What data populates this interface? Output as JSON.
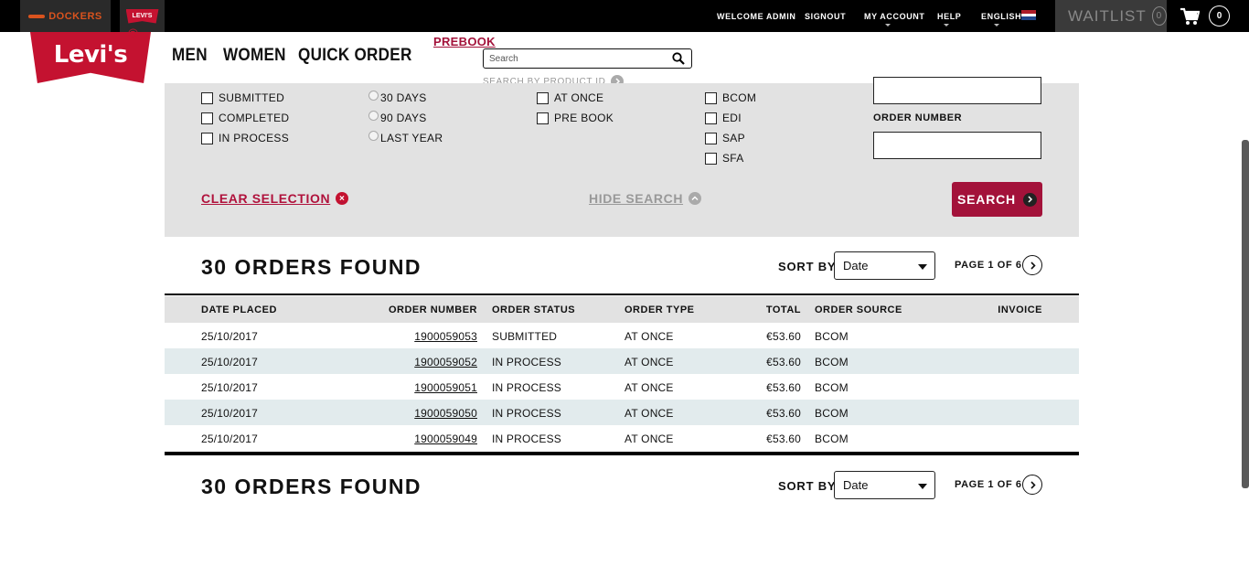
{
  "topbar": {
    "brand_dockers": "DOCKERS",
    "brand_levis": "LEVI'S",
    "welcome": "WELCOME ADMIN",
    "signout": "SIGNOUT",
    "my_account": "MY ACCOUNT",
    "help": "HELP",
    "language": "ENGLISH",
    "waitlist_label": "WAITLIST",
    "waitlist_count": "0",
    "cart_count": "0"
  },
  "header": {
    "logo_text": "Levi's",
    "logo_mark": "®",
    "nav": [
      "MEN",
      "WOMEN",
      "QUICK ORDER"
    ],
    "prebook": "PREBOOK",
    "search_placeholder": "Search",
    "search_by_product": "SEARCH BY PRODUCT ID"
  },
  "filters": {
    "status": [
      "SUBMITTED",
      "COMPLETED",
      "IN PROCESS"
    ],
    "period": [
      "30 DAYS",
      "90 DAYS",
      "LAST YEAR"
    ],
    "order_type": [
      "AT ONCE",
      "PRE BOOK"
    ],
    "source": [
      "BCOM",
      "EDI",
      "SAP",
      "SFA"
    ],
    "order_number_label": "ORDER NUMBER",
    "clear_selection": "CLEAR SELECTION",
    "hide_search": "HIDE SEARCH",
    "search_button": "SEARCH"
  },
  "results": {
    "found_label": "30 ORDERS FOUND",
    "sort_by_label": "SORT BY:",
    "sort_value": "Date",
    "page_info": "PAGE 1 OF 6"
  },
  "table": {
    "headers": [
      "DATE PLACED",
      "ORDER NUMBER",
      "ORDER STATUS",
      "ORDER TYPE",
      "TOTAL",
      "ORDER SOURCE",
      "INVOICE"
    ],
    "rows": [
      {
        "date": "25/10/2017",
        "number": "1900059053",
        "status": "SUBMITTED",
        "type": "AT ONCE",
        "total": "€53.60",
        "source": "BCOM"
      },
      {
        "date": "25/10/2017",
        "number": "1900059052",
        "status": "IN PROCESS",
        "type": "AT ONCE",
        "total": "€53.60",
        "source": "BCOM"
      },
      {
        "date": "25/10/2017",
        "number": "1900059051",
        "status": "IN PROCESS",
        "type": "AT ONCE",
        "total": "€53.60",
        "source": "BCOM"
      },
      {
        "date": "25/10/2017",
        "number": "1900059050",
        "status": "IN PROCESS",
        "type": "AT ONCE",
        "total": "€53.60",
        "source": "BCOM"
      },
      {
        "date": "25/10/2017",
        "number": "1900059049",
        "status": "IN PROCESS",
        "type": "AT ONCE",
        "total": "€53.60",
        "source": "BCOM"
      }
    ]
  },
  "colors": {
    "brand_red": "#c41230",
    "accent_crimson": "#a3123a",
    "panel_gray": "#e2e2e2",
    "row_alt": "#e2ebed"
  },
  "icons": [
    "search-icon",
    "cart-icon",
    "flag-icon",
    "arrow-right-circle-icon",
    "close-circle-icon",
    "chevron-up-circle-icon",
    "dropdown-caret-icon"
  ]
}
